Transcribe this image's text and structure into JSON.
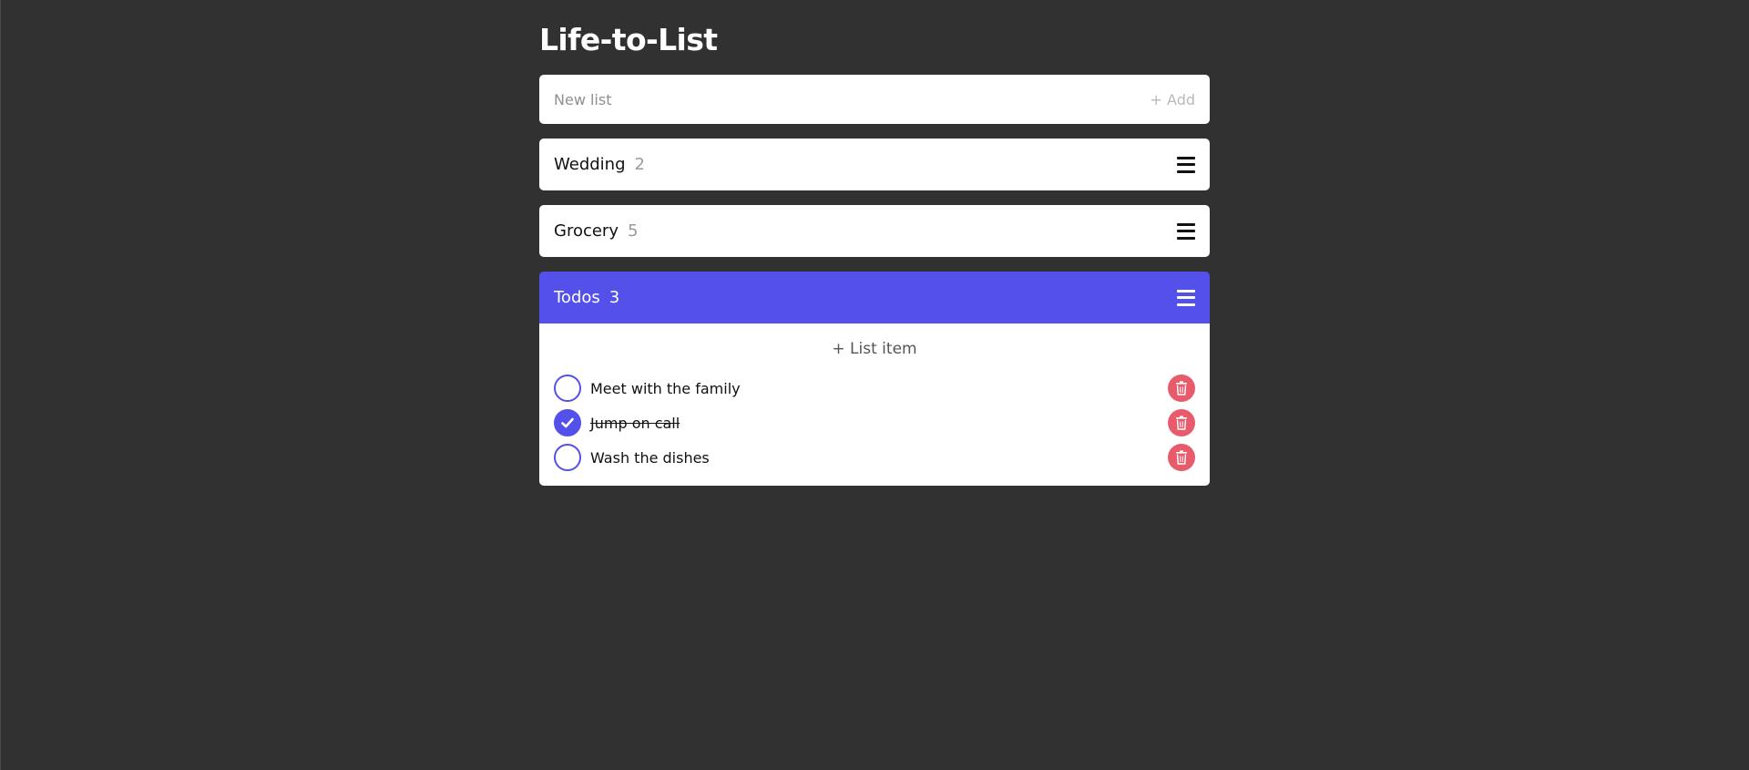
{
  "app": {
    "title": "Life-to-List"
  },
  "new_list": {
    "placeholder": "New list",
    "add_label": "+ Add"
  },
  "lists": [
    {
      "name": "Wedding",
      "count": "2",
      "active": false
    },
    {
      "name": "Grocery",
      "count": "5",
      "active": false
    },
    {
      "name": "Todos",
      "count": "3",
      "active": true
    }
  ],
  "active_list": {
    "add_item_label": "+ List item",
    "items": [
      {
        "text": "Meet with the family",
        "done": false
      },
      {
        "text": "Jump on call",
        "done": true
      },
      {
        "text": "Wash the dishes",
        "done": false
      }
    ]
  },
  "colors": {
    "background": "#313131",
    "accent": "#5351ea",
    "delete": "#e85b6a",
    "card": "#ffffff"
  },
  "icons": {
    "list_menu": "hamburger-menu-icon",
    "item_done": "checkmark-icon",
    "item_delete": "trash-icon"
  }
}
